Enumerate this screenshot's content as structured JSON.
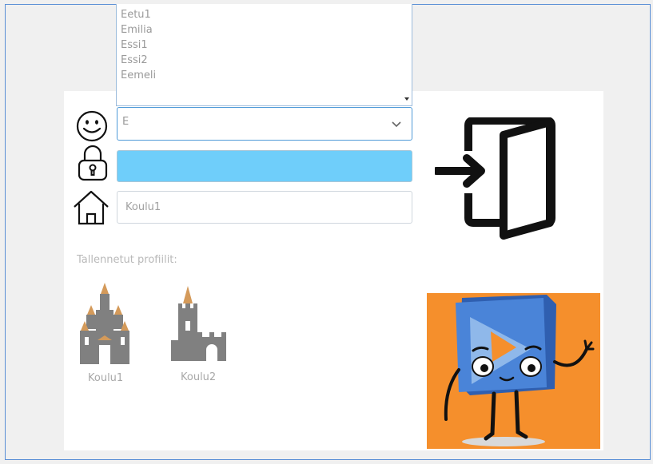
{
  "user_list": {
    "items": [
      "Eetu1",
      "Emilia",
      "Essi1",
      "Essi2",
      "Eemeli"
    ]
  },
  "username": {
    "value": "E"
  },
  "password": {
    "value": ""
  },
  "school": {
    "value": "Koulu1"
  },
  "saved_profiles": {
    "label": "Tallennetut profiilit:",
    "profiles": [
      {
        "name": "Koulu1",
        "icon": "castle-icon"
      },
      {
        "name": "Koulu2",
        "icon": "tower-icon"
      }
    ]
  },
  "colors": {
    "password_fill": "#6fcefa",
    "frame_border": "#5a8fd6",
    "mascot_background": "#f58f2c",
    "mascot_body": "#3d6fc8"
  },
  "icons": [
    "smiley-icon",
    "lock-icon",
    "house-icon",
    "chevron-down-icon",
    "login-door-icon",
    "mascot-image"
  ]
}
